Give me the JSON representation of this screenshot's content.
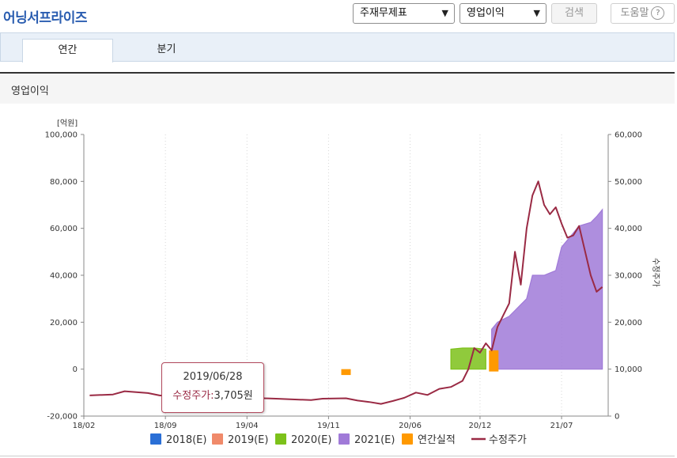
{
  "header": {
    "title": "어닝서프라이즈",
    "select_statement": "주재무제표",
    "select_metric": "영업이익",
    "search_label": "검색",
    "help_label": "도움말",
    "help_icon": "?"
  },
  "tabs": [
    {
      "label": "연간",
      "active": true
    },
    {
      "label": "분기",
      "active": false
    }
  ],
  "section_title": "영업이익",
  "tooltip": {
    "date": "2019/06/28",
    "label": "수정주가",
    "value": "3,705원"
  },
  "chart_data": {
    "type": "area",
    "left_unit": "[억원]",
    "right_label": "수정주가",
    "left_axis": {
      "min": -20000,
      "max": 100000,
      "ticks": [
        "100,000",
        "80,000",
        "60,000",
        "40,000",
        "20,000",
        "0",
        "-20,000"
      ]
    },
    "right_axis": {
      "min": 0,
      "max": 60000,
      "ticks": [
        "60,000",
        "50,000",
        "40,000",
        "30,000",
        "20,000",
        "10,000",
        "0"
      ]
    },
    "x_ticks": [
      "18/02",
      "18/09",
      "19/04",
      "19/11",
      "20/06",
      "20/12",
      "21/07"
    ],
    "grid": "vertical-dotted",
    "legend_position": "bottom",
    "legend": [
      {
        "name": "2018(E)",
        "color": "#2a6fd6",
        "shape": "square"
      },
      {
        "name": "2019(E)",
        "color": "#f08a6a",
        "shape": "square"
      },
      {
        "name": "2020(E)",
        "color": "#7cc11a",
        "shape": "square"
      },
      {
        "name": "2021(E)",
        "color": "#a07ad8",
        "shape": "square"
      },
      {
        "name": "연간실적",
        "color": "#ff9900",
        "shape": "square"
      },
      {
        "name": "수정주가",
        "color": "#9a2a44",
        "shape": "line"
      }
    ],
    "series": [
      {
        "name": "2020(E)",
        "axis": "left",
        "kind": "area",
        "color": "#7cc11a",
        "points": [
          [
            "2020-09",
            8500
          ],
          [
            "2020-10",
            9000
          ],
          [
            "2020-11",
            9000
          ],
          [
            "2020-12",
            8500
          ]
        ]
      },
      {
        "name": "2021(E)",
        "axis": "left",
        "kind": "area",
        "color": "#a07ad8",
        "points": [
          [
            "2021-01",
            17000
          ],
          [
            "2021-01",
            20000
          ],
          [
            "2021-02",
            22500
          ],
          [
            "2021-03",
            25000
          ],
          [
            "2021-03",
            27500
          ],
          [
            "2021-04",
            30000
          ],
          [
            "2021-04",
            40000
          ],
          [
            "2021-05",
            40000
          ],
          [
            "2021-06",
            42000
          ],
          [
            "2021-07",
            52000
          ],
          [
            "2021-07",
            55000
          ],
          [
            "2021-08",
            58000
          ],
          [
            "2021-08",
            61000
          ],
          [
            "2021-09",
            62500
          ],
          [
            "2021-10",
            65000
          ],
          [
            "2021-10",
            68000
          ]
        ]
      },
      {
        "name": "연간실적",
        "axis": "left",
        "kind": "bar",
        "color": "#ff9900",
        "points": [
          [
            "2019-12",
            -2500
          ],
          [
            "2020-12",
            0
          ]
        ],
        "second_bar_range": [
          -1000,
          8000
        ]
      },
      {
        "name": "수정주가",
        "axis": "right",
        "kind": "line",
        "color": "#9a2a44",
        "points": [
          [
            "2018-02",
            4400
          ],
          [
            "2018-04",
            4600
          ],
          [
            "2018-05",
            5300
          ],
          [
            "2018-07",
            4900
          ],
          [
            "2018-08",
            4400
          ],
          [
            "2018-09",
            4300
          ],
          [
            "2018-10",
            4400
          ],
          [
            "2018-11",
            4000
          ],
          [
            "2018-12",
            4300
          ],
          [
            "2019-01",
            3900
          ],
          [
            "2019-03",
            4300
          ],
          [
            "2019-05",
            3800
          ],
          [
            "2019-06",
            3705
          ],
          [
            "2019-07",
            3600
          ],
          [
            "2019-09",
            3400
          ],
          [
            "2019-10",
            3700
          ],
          [
            "2019-12",
            3800
          ],
          [
            "2020-01",
            3300
          ],
          [
            "2020-02",
            3000
          ],
          [
            "2020-03",
            2600
          ],
          [
            "2020-04",
            3200
          ],
          [
            "2020-05",
            3900
          ],
          [
            "2020-06",
            5000
          ],
          [
            "2020-07",
            4500
          ],
          [
            "2020-08",
            5800
          ],
          [
            "2020-09",
            6200
          ],
          [
            "2020-10",
            7500
          ],
          [
            "2020-11",
            10000
          ],
          [
            "2020-11",
            14500
          ],
          [
            "2020-12",
            13500
          ],
          [
            "2020-12",
            15500
          ],
          [
            "2021-01",
            14000
          ],
          [
            "2021-01",
            19000
          ],
          [
            "2021-02",
            21500
          ],
          [
            "2021-02",
            24000
          ],
          [
            "2021-03",
            35000
          ],
          [
            "2021-03",
            28000
          ],
          [
            "2021-04",
            40000
          ],
          [
            "2021-04",
            47000
          ],
          [
            "2021-05",
            50000
          ],
          [
            "2021-05",
            45000
          ],
          [
            "2021-06",
            43000
          ],
          [
            "2021-06",
            44500
          ],
          [
            "2021-07",
            41000
          ],
          [
            "2021-07",
            38000
          ],
          [
            "2021-08",
            38500
          ],
          [
            "2021-08",
            40500
          ],
          [
            "2021-09",
            30000
          ],
          [
            "2021-10",
            26500
          ],
          [
            "2021-10",
            27500
          ]
        ]
      }
    ]
  }
}
